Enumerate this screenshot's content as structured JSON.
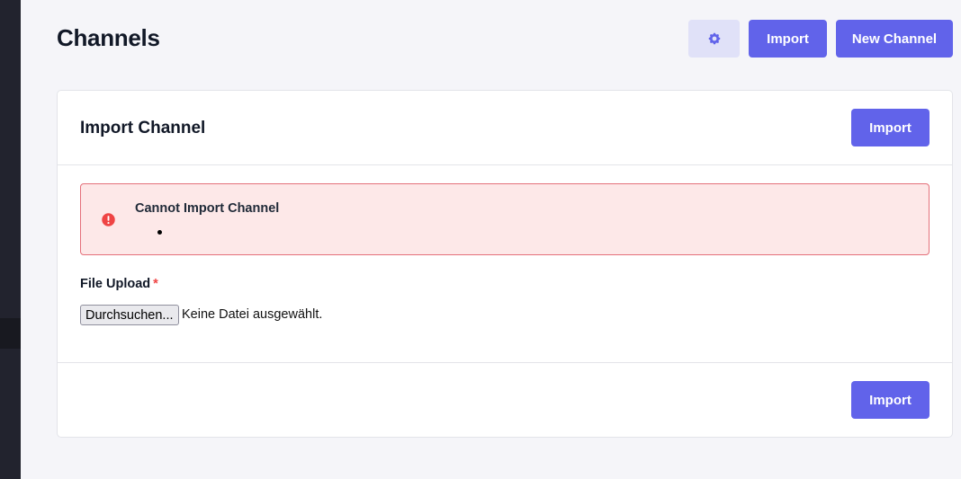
{
  "header": {
    "title": "Channels",
    "settings_icon": "gear-icon",
    "import_label": "Import",
    "new_channel_label": "New Channel"
  },
  "card": {
    "title": "Import Channel",
    "header_import_label": "Import",
    "footer_import_label": "Import",
    "alert": {
      "icon": "exclamation-circle-icon",
      "title": "Cannot Import Channel",
      "messages": [
        ""
      ]
    },
    "file_upload": {
      "label": "File Upload",
      "required_mark": "*",
      "button_label": "Durchsuchen...",
      "status": "Keine Datei ausgewählt."
    }
  },
  "colors": {
    "accent": "#6163ea",
    "accent_light": "#e0e1f8",
    "danger": "#ef4444",
    "alert_bg": "#fde8e8",
    "sidebar": "#22232e"
  }
}
